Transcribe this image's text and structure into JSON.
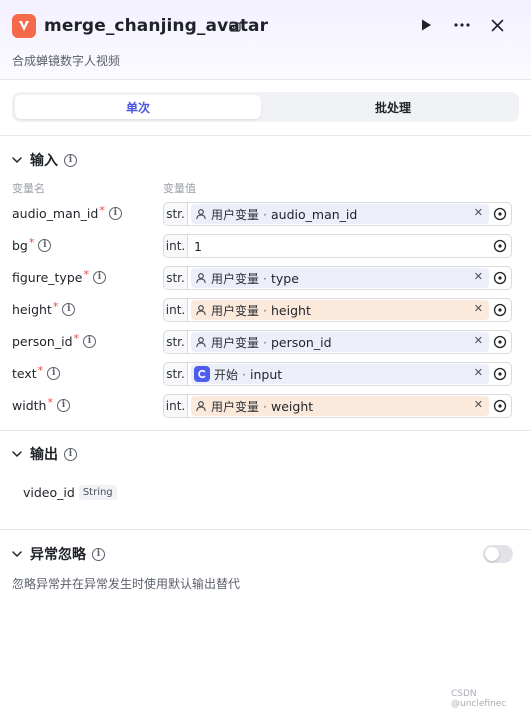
{
  "header": {
    "title": "merge_chanjing_avatar",
    "subtitle": "合成蝉镜数字人视频",
    "logo_icon": "node-logo-icon",
    "accent": "#f46a4b"
  },
  "tabs": [
    {
      "label": "单次",
      "active": true
    },
    {
      "label": "批处理",
      "active": false
    }
  ],
  "input_section": {
    "title": "输入",
    "col_name": "变量名",
    "col_value": "变量值",
    "rows": [
      {
        "name": "audio_man_id",
        "required": true,
        "type": "str.",
        "source": "用户变量",
        "sep": "·",
        "ref": "audio_man_id",
        "style": "var"
      },
      {
        "name": "bg",
        "required": true,
        "type": "int.",
        "value": "1",
        "style": "plain"
      },
      {
        "name": "figure_type",
        "required": true,
        "type": "str.",
        "source": "用户变量",
        "sep": "·",
        "ref": "type",
        "style": "var"
      },
      {
        "name": "height",
        "required": true,
        "type": "int.",
        "source": "用户变量",
        "sep": "·",
        "ref": "height",
        "style": "orange"
      },
      {
        "name": "person_id",
        "required": true,
        "type": "str.",
        "source": "用户变量",
        "sep": "·",
        "ref": "person_id",
        "style": "var"
      },
      {
        "name": "text",
        "required": true,
        "type": "str.",
        "source": "开始",
        "sep": "·",
        "ref": "input",
        "style": "var",
        "start": true
      },
      {
        "name": "width",
        "required": true,
        "type": "int.",
        "source": "用户变量",
        "sep": "·",
        "ref": "weight",
        "style": "orange"
      }
    ]
  },
  "output_section": {
    "title": "输出",
    "items": [
      {
        "name": "video_id",
        "type": "String"
      }
    ]
  },
  "exception_section": {
    "title": "异常忽略",
    "description": "忽略异常并在异常发生时使用默认输出替代",
    "toggle_on": false
  },
  "watermark": "CSDN @unclefinec"
}
